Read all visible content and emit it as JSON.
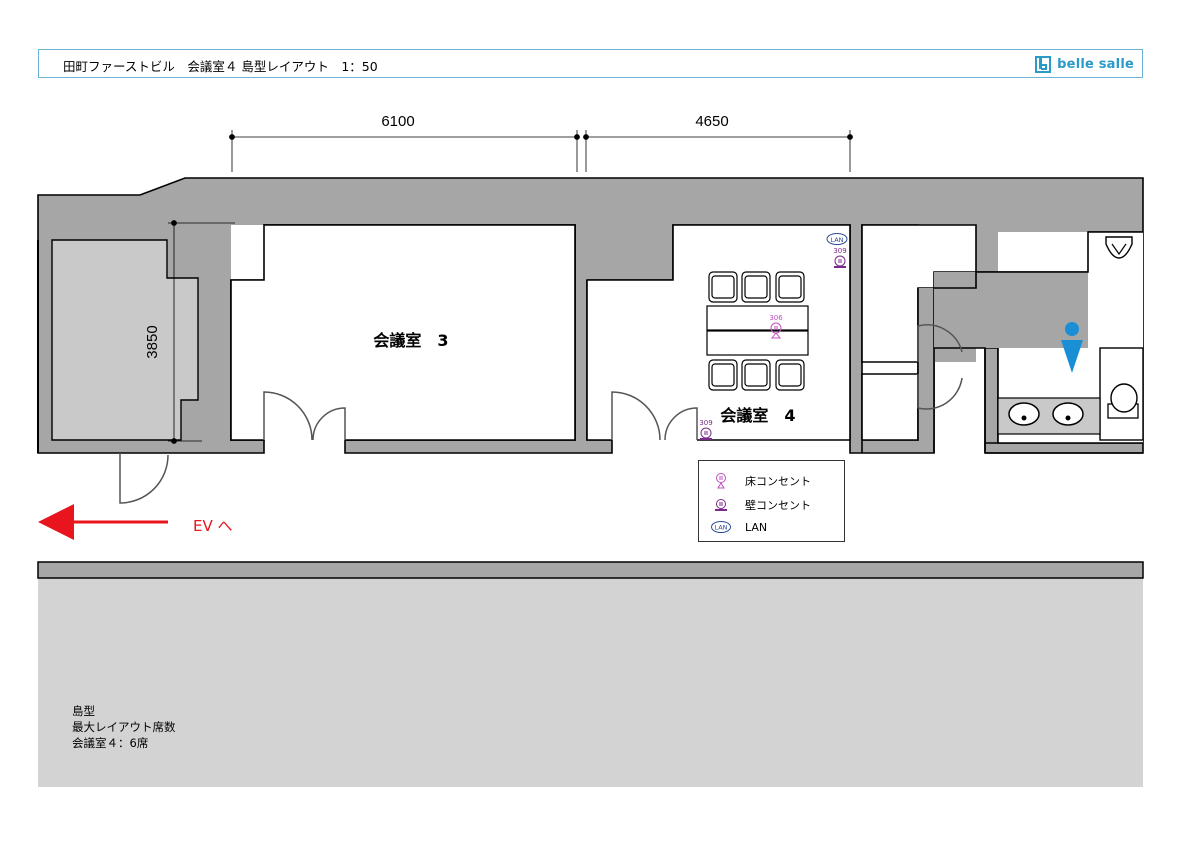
{
  "header": {
    "title": "田町ファーストビル　会議室４ 島型レイアウト　1：50",
    "logo_text": "belle salle"
  },
  "dimensions": {
    "width_left": "6100",
    "width_right": "4650",
    "height": "3850"
  },
  "rooms": {
    "room3": "会議室　3",
    "room4": "会議室　4"
  },
  "outlet_numbers": {
    "floor_center": "306",
    "wall_top_right": "309",
    "wall_bottom_left": "309"
  },
  "lan_badge": "LAN",
  "ev_label": "EV へ",
  "legend": {
    "items": [
      {
        "label": "床コンセント",
        "icon": "floor-outlet-icon"
      },
      {
        "label": "壁コンセント",
        "icon": "wall-outlet-icon"
      },
      {
        "label": "LAN",
        "icon": "lan-icon"
      }
    ]
  },
  "note": {
    "line1": "島型",
    "line2": "最大レイアウト席数",
    "line3": "会議室４：6席"
  },
  "colors": {
    "wall_fill": "#a6a6a6",
    "corridor_fill": "#d3d3d3",
    "header_border": "#6bb4d6",
    "brand_blue": "#2a9ac9",
    "arrow_red": "#e8141e",
    "outlet_pink": "#c04fc0",
    "outlet_purple": "#7a2a8a",
    "lan_blue": "#2d4a9a",
    "restroom_blue": "#1a8fd6"
  }
}
